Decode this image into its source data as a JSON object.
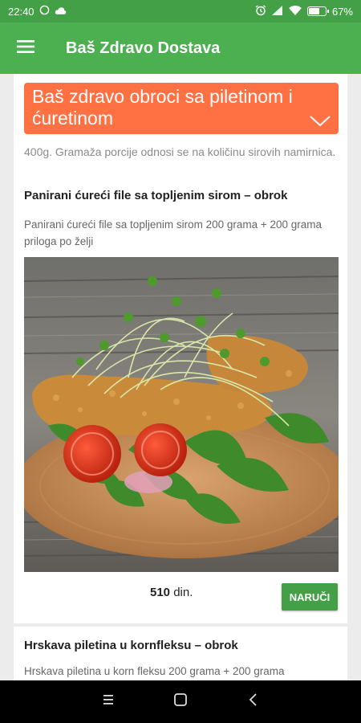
{
  "status_bar": {
    "time": "22:40",
    "battery_text": "67%",
    "battery_level": 0.67
  },
  "app_bar": {
    "title": "Baš Zdravo Dostava"
  },
  "category": {
    "title": "Baš zdravo obroci sa piletinom i ćuretinom"
  },
  "weight_note": "400g. Gramaža porcije odnosi se na količinu sirovih namirnica.",
  "items": [
    {
      "title": "Panirani ćureći file sa topljenim sirom – obrok",
      "description": "Panirani ćureći file sa topljenim sirom 200 grama + 200 grama priloga po želji",
      "price_value": "510",
      "price_currency": "din.",
      "order_label": "NARUČI"
    },
    {
      "title": "Hrskava piletina u kornfleksu – obrok",
      "description": "Hrskava piletina u korn fleksu 200 grama + 200 grama"
    }
  ],
  "icons": {
    "menu": "hamburger-menu-icon",
    "expand": "chevron-down-icon",
    "nav_recents": "recents-icon",
    "nav_home": "home-icon",
    "nav_back": "back-icon"
  },
  "colors": {
    "primary": "#4caf50",
    "status": "#43a047",
    "accent": "#ff7043",
    "button": "#43a047"
  }
}
